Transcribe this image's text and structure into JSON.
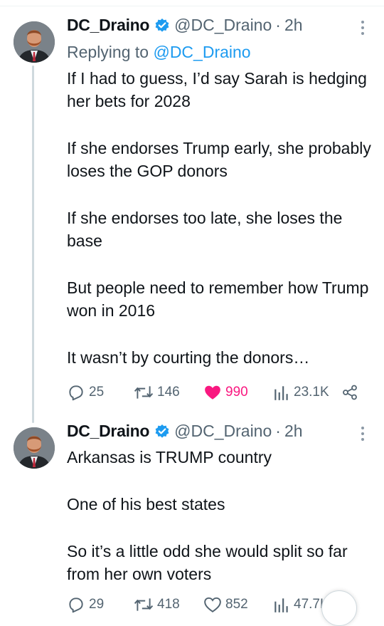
{
  "tweets": [
    {
      "author_name": "DC_Draino",
      "handle": "@DC_Draino",
      "separator": "·",
      "time": "2h",
      "replying_prefix": "Replying to",
      "replying_to": "@DC_Draino",
      "paragraphs": [
        "If I had to guess, I’d say Sarah is hedging her bets for 2028",
        "If she endorses Trump early, she probably loses the GOP donors",
        "If she endorses too late, she loses the base",
        "But people need to remember how Trump won in 2016",
        "It wasn’t by courting the donors…"
      ],
      "stats": {
        "replies": "25",
        "retweets": "146",
        "likes": "990",
        "views": "23.1K"
      }
    },
    {
      "author_name": "DC_Draino",
      "handle": "@DC_Draino",
      "separator": "·",
      "time": "2h",
      "paragraphs": [
        "Arkansas is TRUMP country",
        "One of his best states",
        "So it’s a little odd she would split so far from her own voters"
      ],
      "stats": {
        "replies": "29",
        "retweets": "418",
        "likes": "852",
        "views": "47.7K"
      }
    }
  ],
  "colors": {
    "accent": "#1d9bf0",
    "like": "#f91880",
    "muted": "#536471",
    "verified": "#1d9bf0"
  },
  "icons": [
    "verified-badge-icon",
    "more-icon",
    "reply-icon",
    "retweet-icon",
    "like-icon",
    "views-icon",
    "share-icon",
    "avatar"
  ]
}
